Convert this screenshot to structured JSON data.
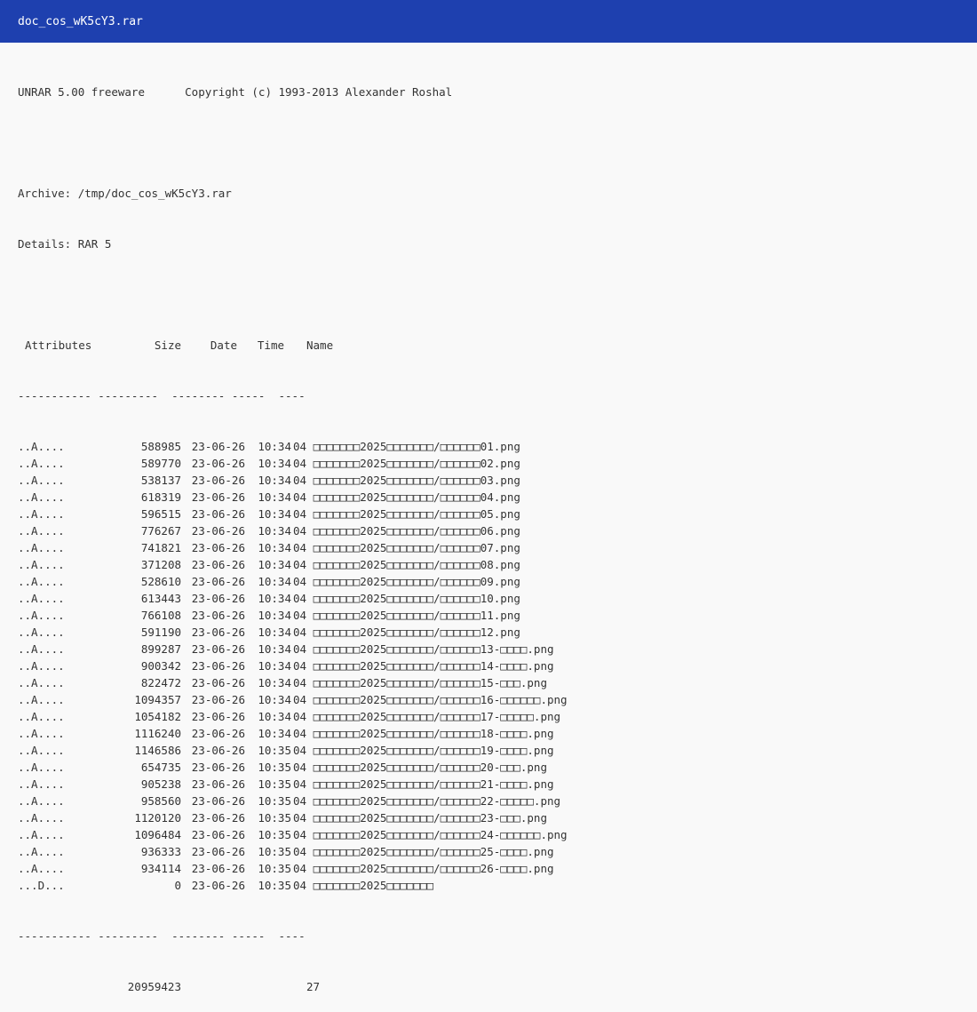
{
  "window": {
    "title": "doc_cos_wK5cY3.rar"
  },
  "output": {
    "banner": "UNRAR 5.00 freeware      Copyright (c) 1993-2013 Alexander Roshal",
    "archive_line": "Archive: /tmp/doc_cos_wK5cY3.rar",
    "details_line": "Details: RAR 5",
    "headers": {
      "attributes": "Attributes",
      "size": "Size",
      "date": "Date",
      "time": "Time",
      "name": "Name"
    },
    "separator": "----------- ---------  -------- -----  ----",
    "rows": [
      {
        "attr": "..A....",
        "size": "588985",
        "date": "23-06-26",
        "time": "10:34",
        "name": "04 □□□□□□□2025□□□□□□□/□□□□□□01.png"
      },
      {
        "attr": "..A....",
        "size": "589770",
        "date": "23-06-26",
        "time": "10:34",
        "name": "04 □□□□□□□2025□□□□□□□/□□□□□□02.png"
      },
      {
        "attr": "..A....",
        "size": "538137",
        "date": "23-06-26",
        "time": "10:34",
        "name": "04 □□□□□□□2025□□□□□□□/□□□□□□03.png"
      },
      {
        "attr": "..A....",
        "size": "618319",
        "date": "23-06-26",
        "time": "10:34",
        "name": "04 □□□□□□□2025□□□□□□□/□□□□□□04.png"
      },
      {
        "attr": "..A....",
        "size": "596515",
        "date": "23-06-26",
        "time": "10:34",
        "name": "04 □□□□□□□2025□□□□□□□/□□□□□□05.png"
      },
      {
        "attr": "..A....",
        "size": "776267",
        "date": "23-06-26",
        "time": "10:34",
        "name": "04 □□□□□□□2025□□□□□□□/□□□□□□06.png"
      },
      {
        "attr": "..A....",
        "size": "741821",
        "date": "23-06-26",
        "time": "10:34",
        "name": "04 □□□□□□□2025□□□□□□□/□□□□□□07.png"
      },
      {
        "attr": "..A....",
        "size": "371208",
        "date": "23-06-26",
        "time": "10:34",
        "name": "04 □□□□□□□2025□□□□□□□/□□□□□□08.png"
      },
      {
        "attr": "..A....",
        "size": "528610",
        "date": "23-06-26",
        "time": "10:34",
        "name": "04 □□□□□□□2025□□□□□□□/□□□□□□09.png"
      },
      {
        "attr": "..A....",
        "size": "613443",
        "date": "23-06-26",
        "time": "10:34",
        "name": "04 □□□□□□□2025□□□□□□□/□□□□□□10.png"
      },
      {
        "attr": "..A....",
        "size": "766108",
        "date": "23-06-26",
        "time": "10:34",
        "name": "04 □□□□□□□2025□□□□□□□/□□□□□□11.png"
      },
      {
        "attr": "..A....",
        "size": "591190",
        "date": "23-06-26",
        "time": "10:34",
        "name": "04 □□□□□□□2025□□□□□□□/□□□□□□12.png"
      },
      {
        "attr": "..A....",
        "size": "899287",
        "date": "23-06-26",
        "time": "10:34",
        "name": "04 □□□□□□□2025□□□□□□□/□□□□□□13-□□□□.png"
      },
      {
        "attr": "..A....",
        "size": "900342",
        "date": "23-06-26",
        "time": "10:34",
        "name": "04 □□□□□□□2025□□□□□□□/□□□□□□14-□□□□.png"
      },
      {
        "attr": "..A....",
        "size": "822472",
        "date": "23-06-26",
        "time": "10:34",
        "name": "04 □□□□□□□2025□□□□□□□/□□□□□□15-□□□.png"
      },
      {
        "attr": "..A....",
        "size": "1094357",
        "date": "23-06-26",
        "time": "10:34",
        "name": "04 □□□□□□□2025□□□□□□□/□□□□□□16-□□□□□□.png"
      },
      {
        "attr": "..A....",
        "size": "1054182",
        "date": "23-06-26",
        "time": "10:34",
        "name": "04 □□□□□□□2025□□□□□□□/□□□□□□17-□□□□□.png"
      },
      {
        "attr": "..A....",
        "size": "1116240",
        "date": "23-06-26",
        "time": "10:34",
        "name": "04 □□□□□□□2025□□□□□□□/□□□□□□18-□□□□.png"
      },
      {
        "attr": "..A....",
        "size": "1146586",
        "date": "23-06-26",
        "time": "10:35",
        "name": "04 □□□□□□□2025□□□□□□□/□□□□□□19-□□□□.png"
      },
      {
        "attr": "..A....",
        "size": "654735",
        "date": "23-06-26",
        "time": "10:35",
        "name": "04 □□□□□□□2025□□□□□□□/□□□□□□20-□□□.png"
      },
      {
        "attr": "..A....",
        "size": "905238",
        "date": "23-06-26",
        "time": "10:35",
        "name": "04 □□□□□□□2025□□□□□□□/□□□□□□21-□□□□.png"
      },
      {
        "attr": "..A....",
        "size": "958560",
        "date": "23-06-26",
        "time": "10:35",
        "name": "04 □□□□□□□2025□□□□□□□/□□□□□□22-□□□□□.png"
      },
      {
        "attr": "..A....",
        "size": "1120120",
        "date": "23-06-26",
        "time": "10:35",
        "name": "04 □□□□□□□2025□□□□□□□/□□□□□□23-□□□.png"
      },
      {
        "attr": "..A....",
        "size": "1096484",
        "date": "23-06-26",
        "time": "10:35",
        "name": "04 □□□□□□□2025□□□□□□□/□□□□□□24-□□□□□□.png"
      },
      {
        "attr": "..A....",
        "size": "936333",
        "date": "23-06-26",
        "time": "10:35",
        "name": "04 □□□□□□□2025□□□□□□□/□□□□□□25-□□□□.png"
      },
      {
        "attr": "..A....",
        "size": "934114",
        "date": "23-06-26",
        "time": "10:35",
        "name": "04 □□□□□□□2025□□□□□□□/□□□□□□26-□□□□.png"
      },
      {
        "attr": "...D...",
        "size": "0",
        "date": "23-06-26",
        "time": "10:35",
        "name": "04 □□□□□□□2025□□□□□□□"
      }
    ],
    "totals": {
      "size": "20959423",
      "count": "27"
    }
  }
}
